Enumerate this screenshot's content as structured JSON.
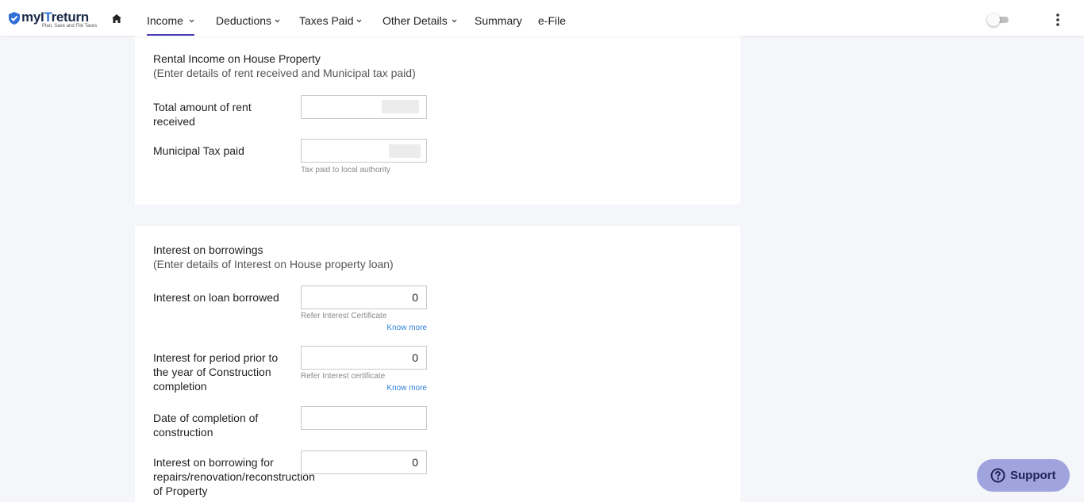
{
  "header": {
    "logo": {
      "brand_prefix": "myI",
      "brand_accent": "T",
      "brand_suffix": "return",
      "tagline": "Plan, Save and File Taxes"
    },
    "nav": [
      {
        "label": "Income",
        "has_chevron": true,
        "active": true
      },
      {
        "label": "Deductions",
        "has_chevron": true,
        "active": false
      },
      {
        "label": "Taxes Paid",
        "has_chevron": true,
        "active": false
      },
      {
        "label": "Other Details",
        "has_chevron": true,
        "active": false
      },
      {
        "label": "Summary",
        "has_chevron": false,
        "active": false
      },
      {
        "label": "e-File",
        "has_chevron": false,
        "active": false
      }
    ],
    "icons": {
      "home": "home-icon",
      "toggle": "theme-toggle",
      "menu": "kebab-menu-icon"
    },
    "accent_color": "#4b3fb8"
  },
  "rental": {
    "title": "Rental Income on House Property",
    "subtitle": "(Enter details of rent received and Municipal tax paid)",
    "rent": {
      "label": "Total amount of rent received",
      "value": ""
    },
    "municipal": {
      "label": "Municipal Tax paid",
      "value": "",
      "help": "Tax paid to local authority"
    }
  },
  "interest": {
    "title": "Interest on borrowings",
    "subtitle": "(Enter details of Interest on House property loan)",
    "loan": {
      "label": "Interest on loan borrowed",
      "value": "0",
      "help": "Refer Interest Certificate",
      "link": "Know more"
    },
    "prior": {
      "label": "Interest for period prior to the year of Construction completion",
      "value": "0",
      "help": "Refer Interest certificate",
      "link": "Know more"
    },
    "completion_date": {
      "label": "Date of completion of construction",
      "value": ""
    },
    "repairs": {
      "label": "Interest on borrowing for repairs/renovation/reconstruction of Property",
      "value": "0"
    }
  },
  "support": {
    "label": "Support",
    "icon": "help-circle-icon",
    "color": "#9fa4de"
  }
}
